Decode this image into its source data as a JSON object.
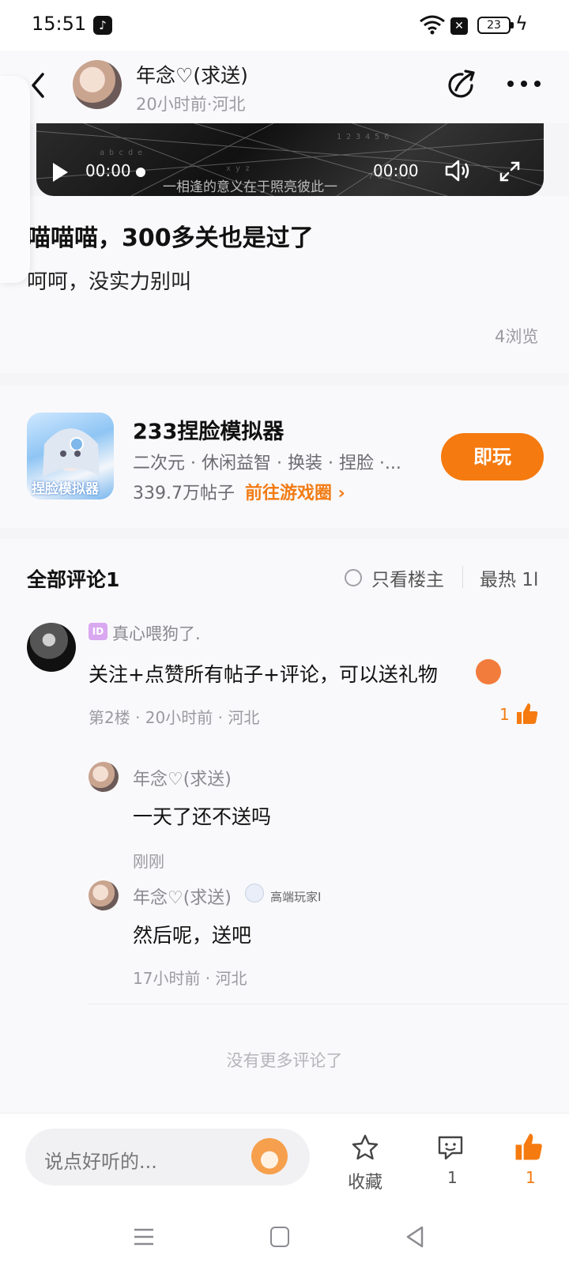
{
  "status_bar": {
    "time": "15:51",
    "battery": "23"
  },
  "header": {
    "author_name": "年念♡(求送)",
    "author_meta": "20小时前·河北"
  },
  "side_panel": {
    "btn1": "u",
    "btn2": "⟲",
    "btn3": "··"
  },
  "video": {
    "time_start": "00:00",
    "time_end": "00:00",
    "subtitle": "一相逢的意义在于照亮彼此一"
  },
  "post": {
    "title": "喵喵喵，300多关也是过了",
    "text": "呵呵，没实力别叫",
    "views": "4浏览"
  },
  "game": {
    "icon_text": "捏脸模拟器",
    "name": "233捏脸模拟器",
    "tags": "二次元 · 休闲益智 · 换装 · 捏脸 ·...",
    "posts": "339.7万帖子",
    "link": "前往游戏圈 ›",
    "play_button": "即玩"
  },
  "comments": {
    "title": "全部评论1",
    "only_op": "只看楼主",
    "sort": "最热 1l",
    "items": [
      {
        "id_badge": "ID",
        "name": "真心喂狗了.",
        "text": "关注+点赞所有帖子+评论，可以送礼物",
        "meta": "第2楼 · 20小时前 · 河北",
        "likes": "1"
      }
    ],
    "replies": [
      {
        "name": "年念♡(求送)",
        "text": "一天了还不送吗",
        "meta": "刚刚"
      },
      {
        "name": "年念♡(求送)",
        "badge": "高端玩家I",
        "text": "然后呢，送吧",
        "meta": "17小时前 · 河北"
      }
    ],
    "no_more": "没有更多评论了"
  },
  "bottom_bar": {
    "placeholder": "说点好听的...",
    "favorite_label": "收藏",
    "comment_count": "1",
    "like_count": "1"
  },
  "colors": {
    "accent": "#f57a0f",
    "background": "#f5f5f7"
  }
}
